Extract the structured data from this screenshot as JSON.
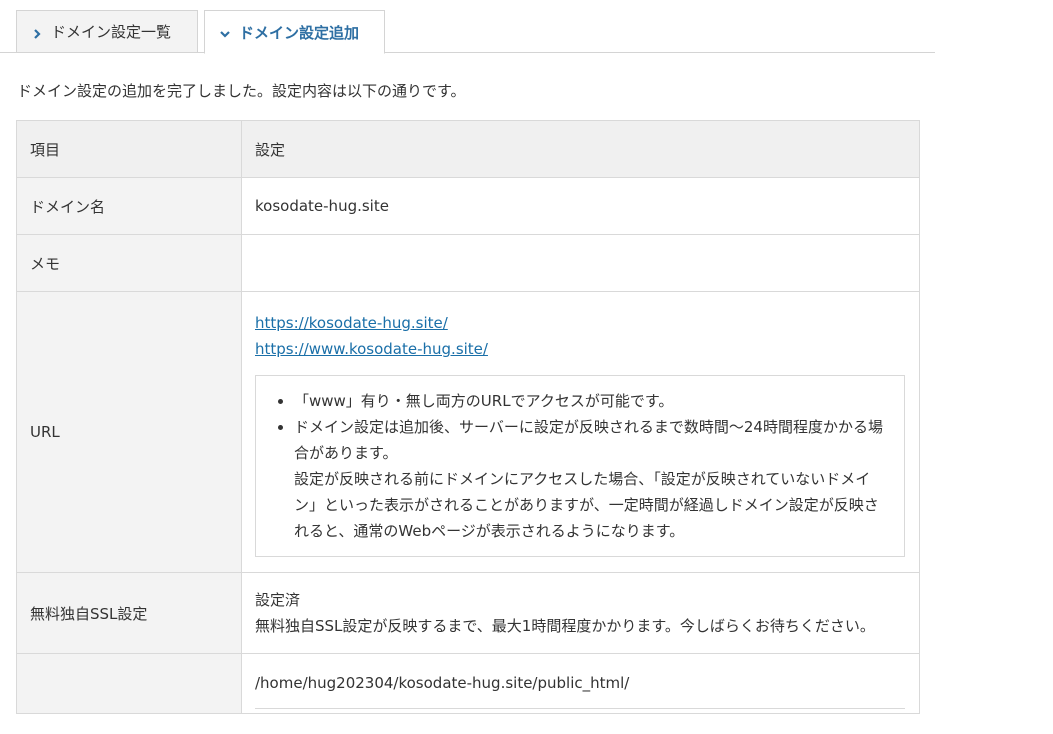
{
  "tabs": [
    {
      "label": "ドメイン設定一覧"
    },
    {
      "label": "ドメイン設定追加"
    }
  ],
  "message": "ドメイン設定の追加を完了しました。設定内容は以下の通りです。",
  "table": {
    "header": {
      "item": "項目",
      "setting": "設定"
    },
    "domain": {
      "label": "ドメイン名",
      "value": "kosodate-hug.site"
    },
    "memo": {
      "label": "メモ",
      "value": ""
    },
    "url": {
      "label": "URL",
      "links": [
        "https://kosodate-hug.site/",
        "https://www.kosodate-hug.site/"
      ],
      "notes": [
        "「www」有り・無し両方のURLでアクセスが可能です。",
        "ドメイン設定は追加後、サーバーに設定が反映されるまで数時間〜24時間程度かかる場合があります。",
        "設定が反映される前にドメインにアクセスした場合、「設定が反映されていないドメイン」といった表示がされることがありますが、一定時間が経過しドメイン設定が反映されると、通常のWebページが表示されるようになります。"
      ]
    },
    "ssl": {
      "label": "無料独自SSL設定",
      "status": "設定済",
      "note": "無料独自SSL設定が反映するまで、最大1時間程度かかります。今しばらくお待ちください。"
    },
    "path": {
      "value": "/home/hug202304/kosodate-hug.site/public_html/"
    }
  },
  "colors": {
    "accent": "#2e6fa3",
    "link": "#1a6fa8",
    "label_bg": "#f3f3f3",
    "border": "#d9d9d9"
  }
}
